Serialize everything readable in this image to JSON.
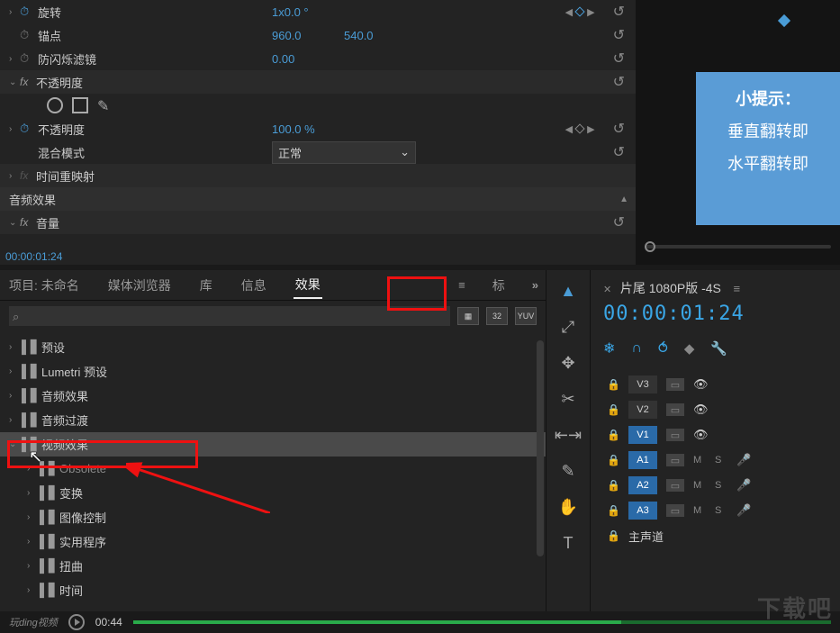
{
  "fx": {
    "rotation": {
      "label": "旋转",
      "value": "1x0.0 °"
    },
    "anchor": {
      "label": "锚点",
      "x": "960.0",
      "y": "540.0"
    },
    "antiflicker": {
      "label": "防闪烁滤镜",
      "value": "0.00"
    },
    "opacity_group": "不透明度",
    "opacity": {
      "label": "不透明度",
      "value": "100.0 %"
    },
    "blend": {
      "label": "混合模式",
      "value": "正常",
      "chevron": "⌄"
    },
    "time_remap": "时间重映射",
    "audio_fx": "音频效果",
    "volume_group": "音量",
    "reset_glyph": "↺",
    "kf_prev": "◀",
    "kf_next": "▶"
  },
  "timecode_small": "00:00:01:24",
  "tip": {
    "title": "小提示：",
    "line1": "垂直翻转即",
    "line2": "水平翻转即"
  },
  "tabs": {
    "project": "项目: 未命名",
    "media": "媒体浏览器",
    "library": "库",
    "info": "信息",
    "effects": "效果",
    "markers": "标",
    "overflow": "»",
    "menu": "≡"
  },
  "search": {
    "placeholder": "",
    "badges": [
      "▦",
      "32",
      "YUV"
    ]
  },
  "tree": [
    {
      "name": "预设"
    },
    {
      "name": "Lumetri 预设"
    },
    {
      "name": "音频效果"
    },
    {
      "name": "音频过渡"
    },
    {
      "name": "视频效果",
      "selected": true,
      "open": true
    },
    {
      "name": "Obsolete",
      "indent": 1,
      "dim": true
    },
    {
      "name": "变换",
      "indent": 1
    },
    {
      "name": "图像控制",
      "indent": 1
    },
    {
      "name": "实用程序",
      "indent": 1
    },
    {
      "name": "扭曲",
      "indent": 1
    },
    {
      "name": "时间",
      "indent": 1
    }
  ],
  "tools": [
    "▲",
    "⤢",
    "✥",
    "✂",
    "⇤⇥",
    "✎",
    "✋",
    "T"
  ],
  "timeline": {
    "title": "片尾 1080P版 -4S",
    "time": "00:00:01:24",
    "tracks_v": [
      {
        "name": "V3",
        "on": false
      },
      {
        "name": "V2",
        "on": false
      },
      {
        "name": "V1",
        "on": true
      }
    ],
    "tracks_a": [
      {
        "name": "A1",
        "on": true
      },
      {
        "name": "A2",
        "on": true
      },
      {
        "name": "A3",
        "on": true
      }
    ],
    "master": "主声道",
    "eye": "👁",
    "m": "M",
    "s": "S",
    "mic": "🎤",
    "lock": "🔒",
    "strip": "▭"
  },
  "video": {
    "logo": "玩ding视频",
    "time": "00:44"
  },
  "watermark": "下载吧"
}
